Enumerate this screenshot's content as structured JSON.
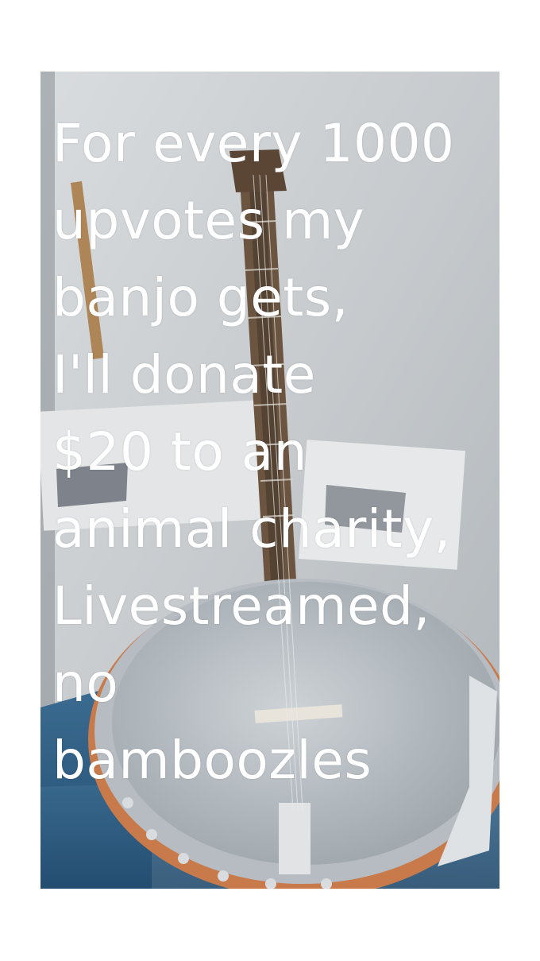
{
  "caption": {
    "lines": [
      "For every 1000",
      "upvotes my",
      "banjo gets,",
      "I'll donate",
      "$20 to an",
      "animal charity,",
      "Livestreamed,",
      "no",
      "bamboozles"
    ]
  },
  "photo": {
    "subject": "banjo-photo",
    "colors": {
      "wall": "#cfd3d5",
      "floor": "#2d5f86",
      "banjo_head": "#b9bfc4",
      "banjo_rim": "#c97a4a",
      "neck": "#6b5440"
    }
  }
}
